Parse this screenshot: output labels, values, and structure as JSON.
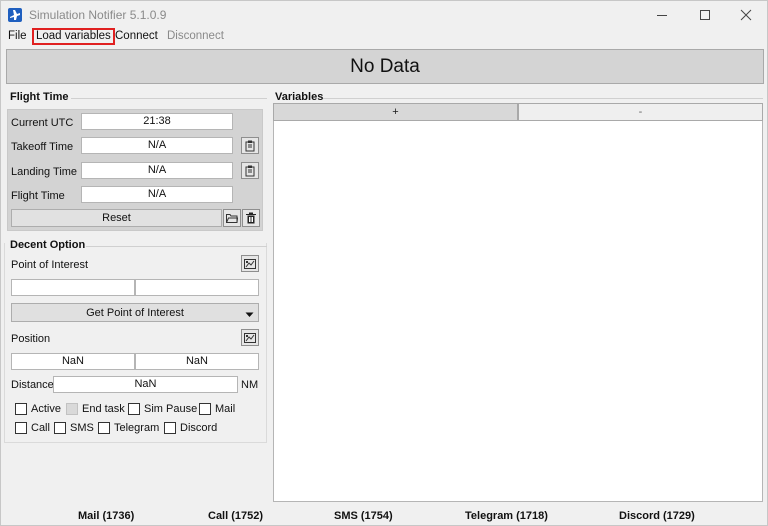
{
  "window": {
    "title": "Simulation Notifier 5.1.0.9"
  },
  "menu": {
    "file": "File",
    "load_variables": "Load variables",
    "connect": "Connect",
    "disconnect": "Disconnect"
  },
  "banner": {
    "text": "No Data"
  },
  "flight_time": {
    "title": "Flight Time",
    "current_utc_label": "Current UTC",
    "current_utc_value": "21:38",
    "takeoff_label": "Takeoff Time",
    "takeoff_value": "N/A",
    "landing_label": "Landing Time",
    "landing_value": "N/A",
    "flight_label": "Flight Time",
    "flight_value": "N/A",
    "reset_label": "Reset"
  },
  "decent": {
    "title": "Decent Option",
    "poi_label": "Point of Interest",
    "poi_field1": "",
    "poi_field2": "",
    "get_poi_label": "Get Point of Interest",
    "position_label": "Position",
    "position_lat": "NaN",
    "position_lon": "NaN",
    "distance_label": "Distance",
    "distance_value": "NaN",
    "distance_unit": "NM",
    "checkboxes": {
      "active": "Active",
      "end_task": "End task",
      "sim_pause": "Sim Pause",
      "mail": "Mail",
      "call": "Call",
      "sms": "SMS",
      "telegram": "Telegram",
      "discord": "Discord"
    }
  },
  "variables": {
    "title": "Variables",
    "add_label": "+",
    "remove_label": "-"
  },
  "status": {
    "mail": "Mail (1736)",
    "call": "Call (1752)",
    "sms": "SMS (1754)",
    "telegram": "Telegram (1718)",
    "discord": "Discord (1729)"
  }
}
